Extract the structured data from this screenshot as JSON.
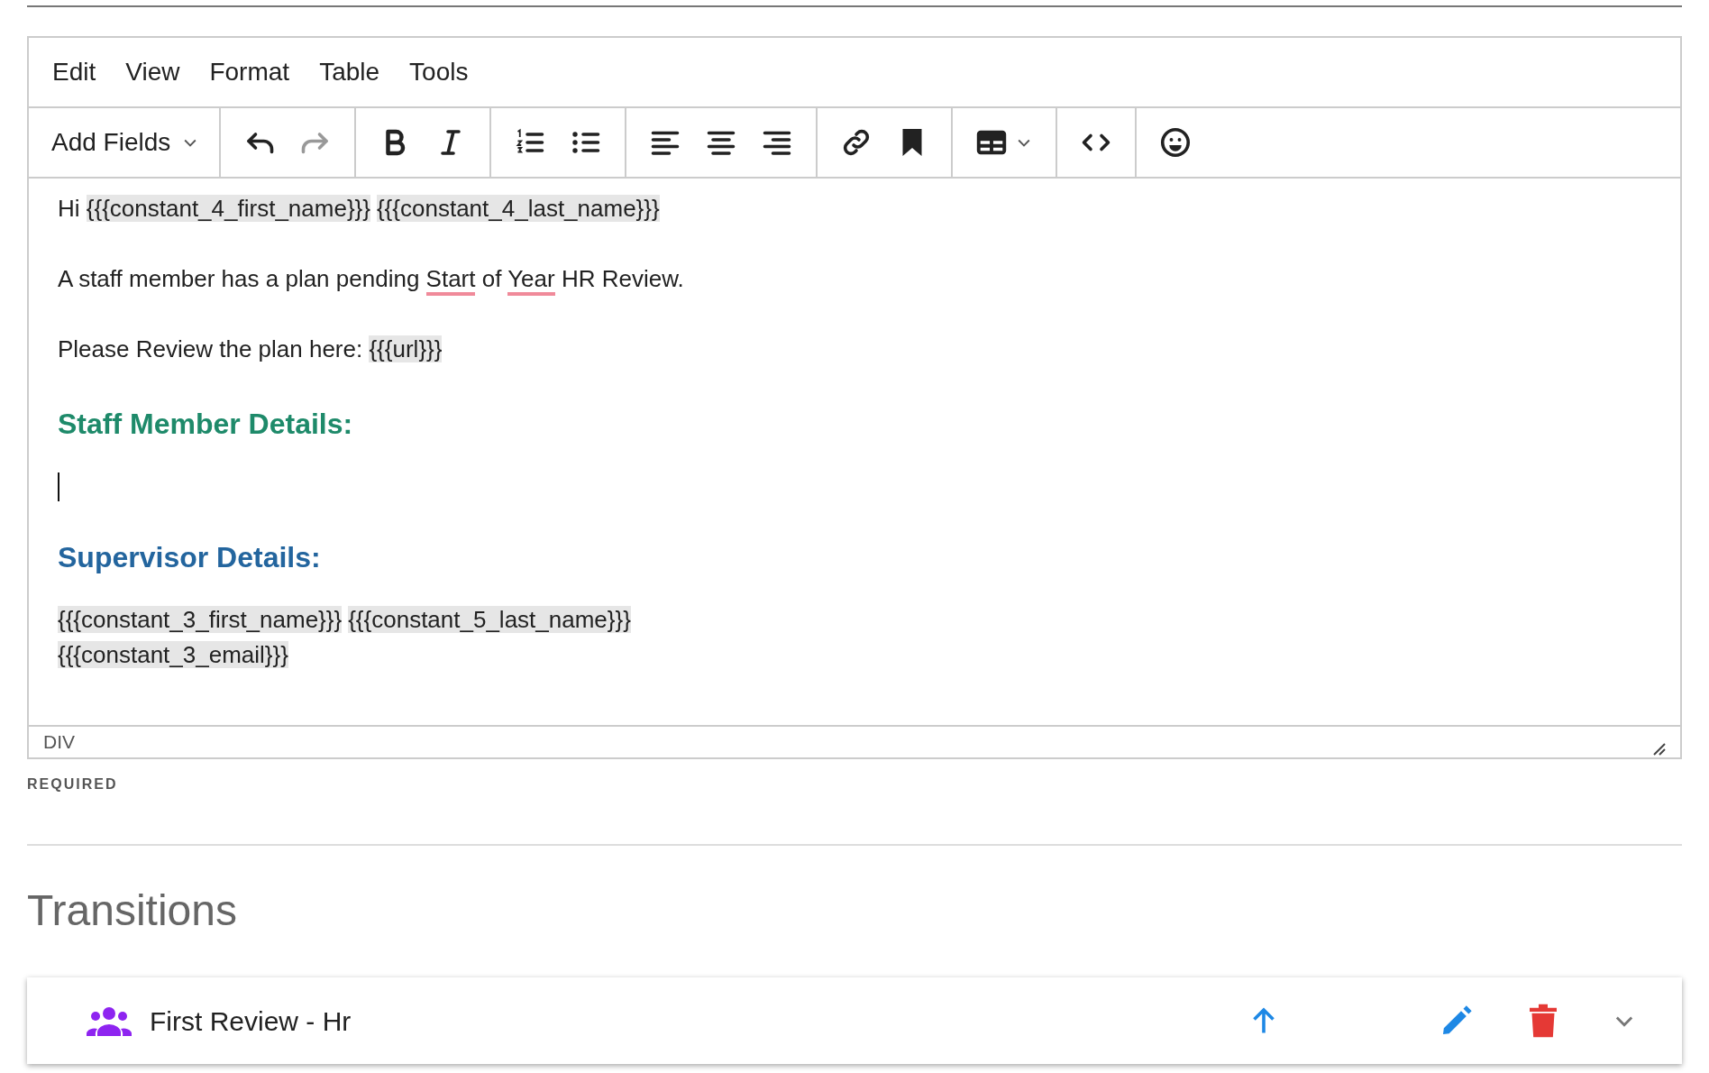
{
  "menubar": [
    {
      "label": "Edit"
    },
    {
      "label": "View"
    },
    {
      "label": "Format"
    },
    {
      "label": "Table"
    },
    {
      "label": "Tools"
    }
  ],
  "toolbar": {
    "dropdown": {
      "label": "Add Fields"
    },
    "groups": [
      [
        {
          "disabled": false
        },
        {
          "disabled": true
        }
      ],
      [
        {
          "disabled": false
        },
        {
          "disabled": false
        }
      ],
      [
        {
          "disabled": false
        },
        {
          "disabled": false
        }
      ],
      [
        {
          "disabled": false
        },
        {
          "disabled": false
        },
        {
          "disabled": false
        }
      ],
      [
        {
          "disabled": false
        },
        {
          "disabled": false
        }
      ],
      [
        {
          "disabled": false
        }
      ],
      [
        {
          "disabled": false
        }
      ],
      [
        {
          "disabled": false
        }
      ]
    ]
  },
  "content": [
    {
      "kind": "paragraph",
      "lines": [
        [
          {
            "kind": "text",
            "text": "Hi "
          },
          {
            "kind": "field",
            "text": "{{{constant_4_first_name}}}"
          },
          {
            "kind": "field",
            "text": "{{{constant_4_last_name}}}"
          }
        ]
      ]
    },
    {
      "kind": "paragraph",
      "lines": [
        [
          {
            "kind": "text",
            "text": "A staff member has a plan pending "
          },
          {
            "kind": "misspelled",
            "text": "Start"
          },
          {
            "kind": "text",
            "text": " of "
          },
          {
            "kind": "misspelled",
            "text": "Year"
          },
          {
            "kind": "text",
            "text": " HR Review."
          }
        ]
      ]
    },
    {
      "kind": "paragraph",
      "lines": [
        [
          {
            "kind": "text",
            "text": "Please Review the plan here: "
          },
          {
            "kind": "field",
            "text": "{{{url}}}"
          }
        ]
      ]
    },
    {
      "kind": "heading",
      "text": "Staff Member Details:",
      "color": "#1e8a6a"
    },
    {
      "kind": "caret"
    },
    {
      "kind": "heading",
      "text": "Supervisor Details:",
      "color": "#23659e"
    },
    {
      "kind": "paragraph",
      "lines": [
        [
          {
            "kind": "field",
            "text": "{{{constant_3_first_name}}}"
          },
          {
            "kind": "field",
            "text": "{{{constant_5_last_name}}}"
          }
        ],
        [
          {
            "kind": "field",
            "text": "{{{constant_3_email}}}"
          }
        ]
      ]
    }
  ],
  "status_bar": {
    "path": "DIV"
  },
  "required_label": "REQUIRED",
  "section_title": "Transitions",
  "transitions": [
    {
      "name": "First Review - Hr"
    }
  ]
}
